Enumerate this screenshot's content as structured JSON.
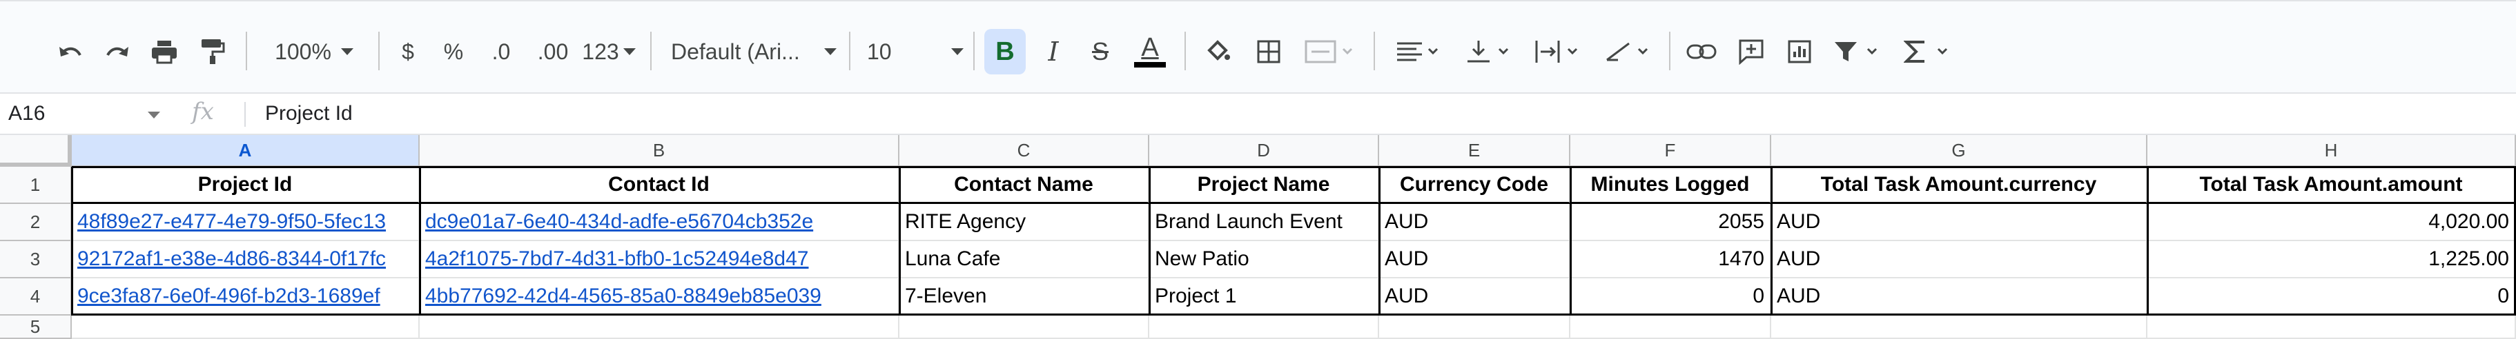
{
  "toolbar": {
    "zoom": "100%",
    "currency_symbol": "$",
    "percent_symbol": "%",
    "decrease_decimal": ".0",
    "increase_decimal": ".00",
    "more_formats": "123",
    "font_family": "Default (Ari...",
    "font_size": "10",
    "bold_letter": "B",
    "italic_letter": "I",
    "strike_letter": "S",
    "text_color_letter": "A"
  },
  "formula_bar": {
    "cell_ref": "A16",
    "fx_label": "fx",
    "value": "Project Id"
  },
  "columns": [
    "A",
    "B",
    "C",
    "D",
    "E",
    "F",
    "G",
    "H"
  ],
  "row_numbers": [
    "1",
    "2",
    "3",
    "4",
    "5"
  ],
  "headers": [
    "Project Id",
    "Contact Id",
    "Contact Name",
    "Project Name",
    "Currency Code",
    "Minutes Logged",
    "Total Task Amount.currency",
    "Total Task Amount.amount"
  ],
  "rows": [
    [
      "48f89e27-e477-4e79-9f50-5fec13",
      "dc9e01a7-6e40-434d-adfe-e56704cb352e",
      "RITE Agency",
      "Brand Launch Event",
      "AUD",
      "2055",
      "AUD",
      "4,020.00"
    ],
    [
      "92172af1-e38e-4d86-8344-0f17fc",
      "4a2f1075-7bd7-4d31-bfb0-1c52494e8d47",
      "Luna Cafe",
      "New Patio",
      "AUD",
      "1470",
      "AUD",
      "1,225.00"
    ],
    [
      "9ce3fa87-6e0f-496f-b2d3-1689ef",
      "4bb77692-42d4-4565-85a0-8849eb85e039",
      "7-Eleven",
      "Project 1",
      "AUD",
      "0",
      "AUD",
      "0"
    ]
  ],
  "colors": {
    "link": "#1155cc",
    "selection": "#1a73e8",
    "toolbar_bg": "#f9fbfd",
    "bold_active_bg": "#d3e3fd"
  }
}
